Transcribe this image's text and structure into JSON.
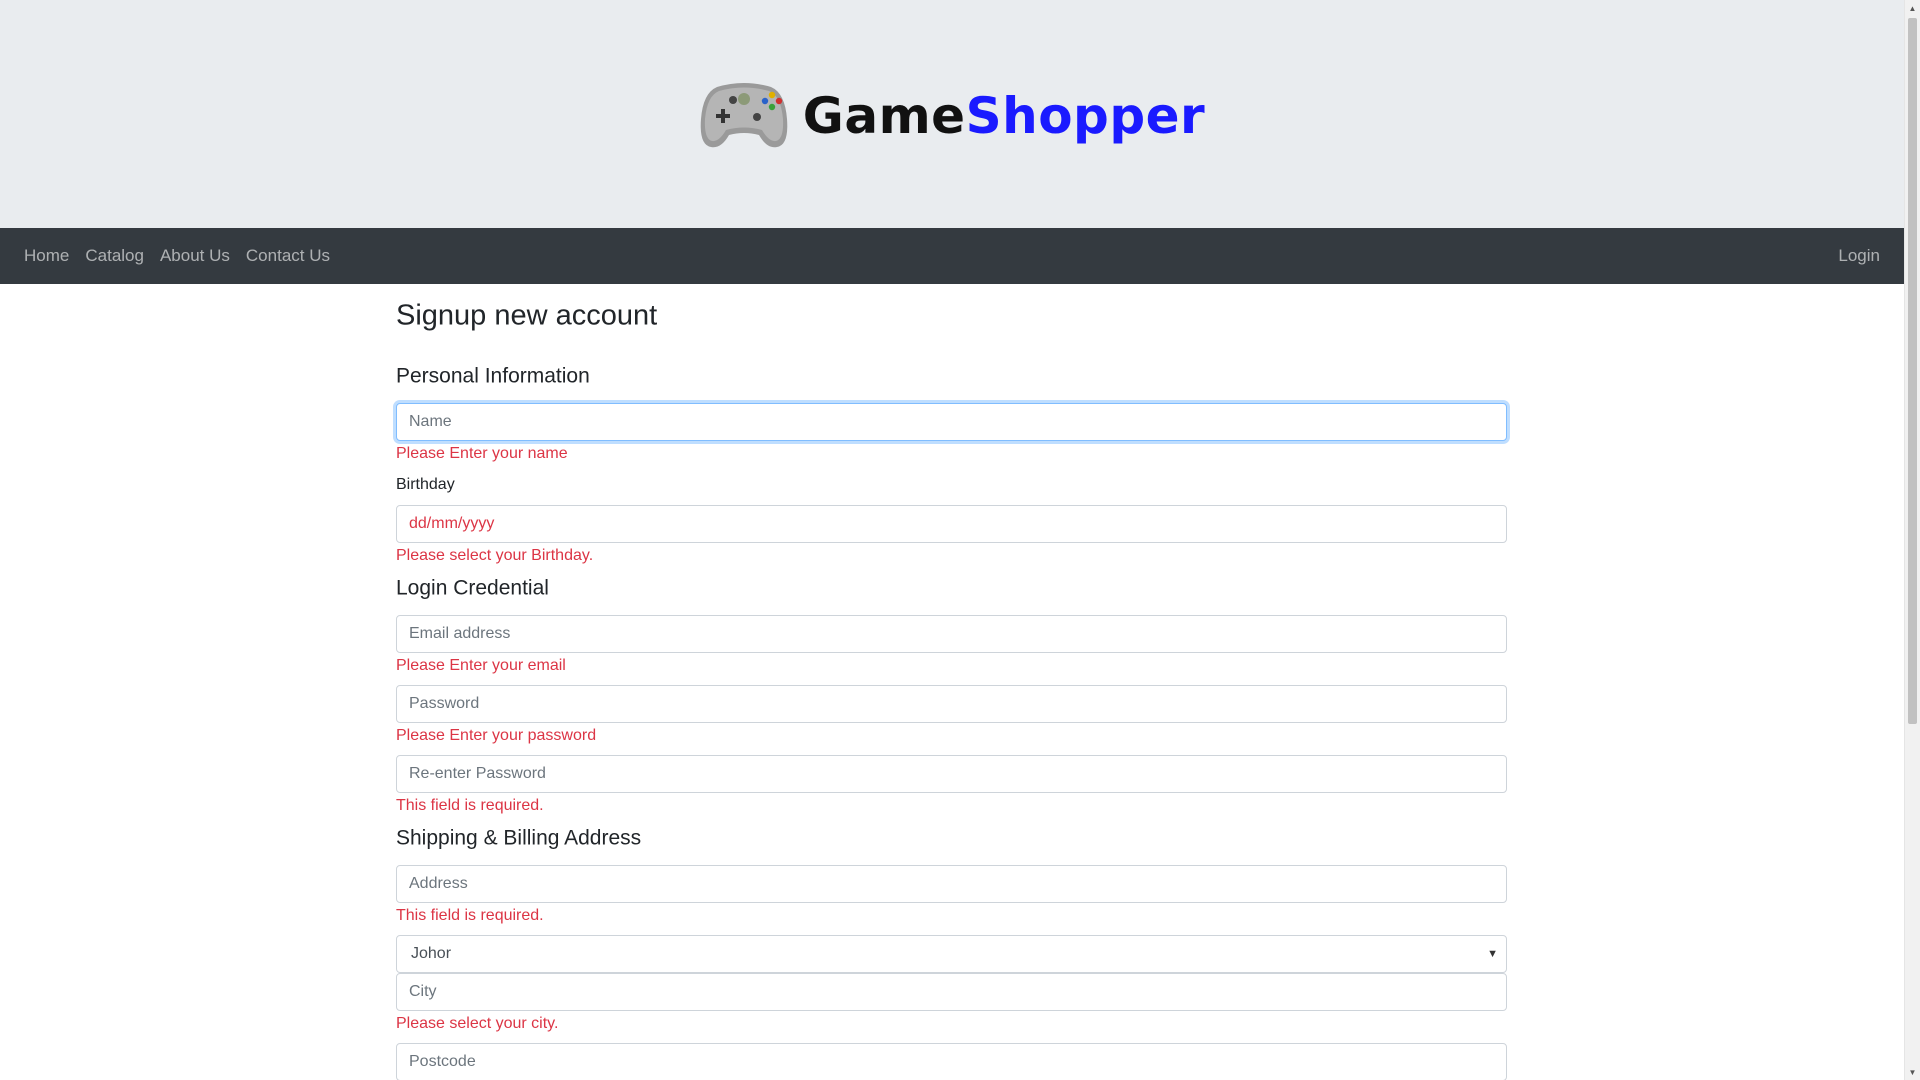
{
  "brand": {
    "name_part1": "Game",
    "name_part2": "Shopper",
    "logo_icon": "gamepad-icon",
    "colors": {
      "part1": "#111111",
      "part2": "#1a1aff"
    }
  },
  "nav": {
    "items": [
      {
        "label": "Home"
      },
      {
        "label": "Catalog"
      },
      {
        "label": "About Us"
      },
      {
        "label": "Contact Us"
      }
    ],
    "login_label": "Login"
  },
  "form": {
    "title": "Signup new account",
    "personal": {
      "section_title": "Personal Information",
      "name_placeholder": "Name",
      "name_error": "Please Enter your name",
      "birthday_label": "Birthday",
      "birthday_value": "dd/mm/yyyy",
      "birthday_error": "Please select your Birthday."
    },
    "login": {
      "section_title": "Login Credential",
      "email_placeholder": "Email address",
      "email_error": "Please Enter your email",
      "password_placeholder": "Password",
      "password_error": "Please Enter your password",
      "repassword_placeholder": "Re-enter Password",
      "repassword_error": "This field is required."
    },
    "address": {
      "section_title": "Shipping & Billing Address",
      "address_placeholder": "Address",
      "address_error": "This field is required.",
      "state_selected": "Johor",
      "city_placeholder": "City",
      "city_error": "Please select your city.",
      "postcode_placeholder": "Postcode"
    }
  },
  "colors": {
    "error": "#dc3545",
    "navbar": "#343a40",
    "header_bg": "#e9ecef"
  }
}
